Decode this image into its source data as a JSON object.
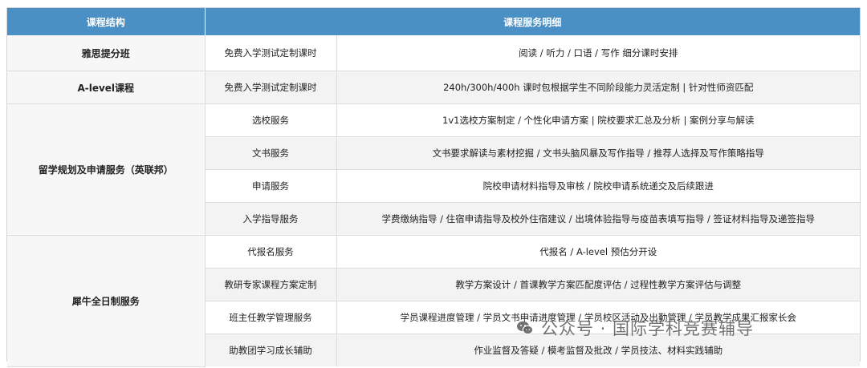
{
  "table": {
    "header": {
      "col1": "课程结构",
      "col2": "课程服务明细"
    },
    "groups": [
      {
        "course": "雅思提分班",
        "rows": [
          {
            "service": "免费入学测试定制课时",
            "detail": "阅读 / 听力 / 口语 / 写作 细分课时安排"
          }
        ]
      },
      {
        "course": "A-level课程",
        "rows": [
          {
            "service": "免费入学测试定制课时",
            "detail": "240h/300h/400h 课时包根据学生不同阶段能力灵活定制 | 针对性师资匹配"
          }
        ]
      },
      {
        "course": "留学规划及申请服务（英联邦）",
        "rows": [
          {
            "service": "选校服务",
            "detail": "1v1选校方案制定 / 个性化申请方案 | 院校要求汇总及分析 | 案例分享与解读"
          },
          {
            "service": "文书服务",
            "detail": "文书要求解读与素材挖掘 / 文书头脑风暴及写作指导 / 推荐人选择及写作策略指导"
          },
          {
            "service": "申请服务",
            "detail": "院校申请材料指导及审核 / 院校申请系统递交及后续跟进"
          },
          {
            "service": "入学指导服务",
            "detail": "学费缴纳指导 / 住宿申请指导及校外住宿建议 / 出境体验指导与疫苗表填写指导 / 签证材料指导及递签指导"
          }
        ]
      },
      {
        "course": "犀牛全日制服务",
        "rows": [
          {
            "service": "代报名服务",
            "detail": "代报名 / A-level 预估分开设"
          },
          {
            "service": "教研专家课程方案定制",
            "detail": "教学方案设计 / 首课教学方案匹配度评估 / 过程性教学方案评估与调整"
          },
          {
            "service": "班主任教学管理服务",
            "detail": "学员课程进度管理 / 学员文书申请进度管理 / 学员校区活动及出勤管理 / 学员教学成果汇报家长会"
          },
          {
            "service": "助教团学习成长辅助",
            "detail": "作业监督及答疑 / 模考监督及批改 / 学员技法、材料实践辅助"
          }
        ]
      }
    ]
  },
  "watermark": {
    "text": "公众号 · 国际学科竞赛辅导",
    "icon": "wechat-icon"
  },
  "colors": {
    "header_bg": "#4a90c4",
    "header_text": "#ffffff",
    "row_alt": "#f3f3f3",
    "border": "#dcdcdc"
  }
}
